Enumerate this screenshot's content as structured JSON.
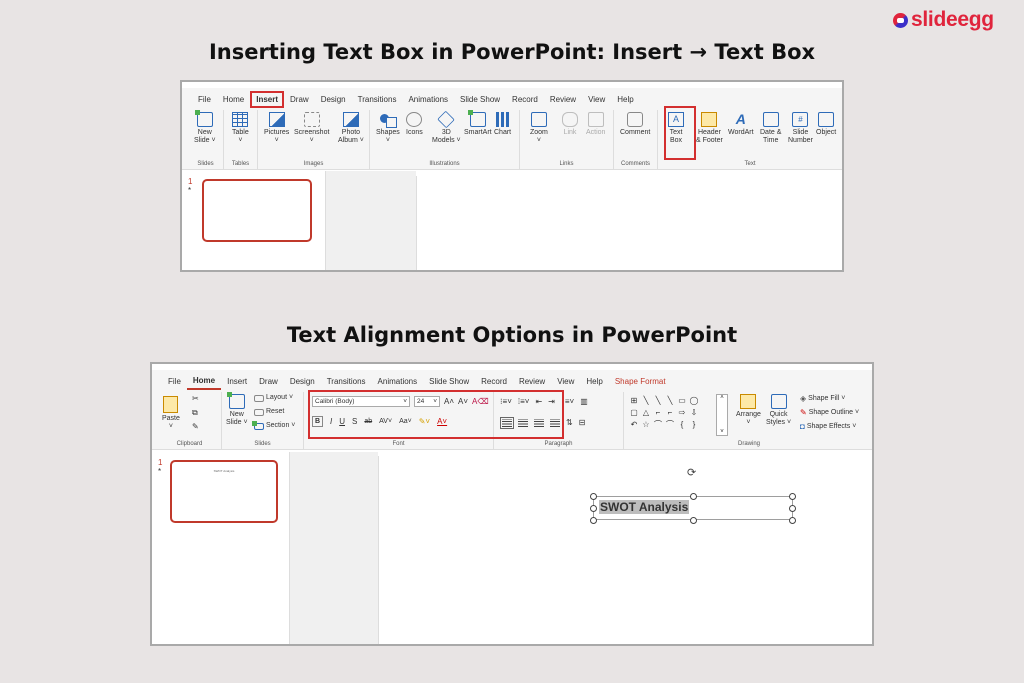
{
  "brand": {
    "name": "slideegg"
  },
  "heading1": "Inserting  Text Box in PowerPoint: Insert → Text Box",
  "heading2": "Text Alignment Options in PowerPoint",
  "shot1": {
    "tabs": [
      "File",
      "Home",
      "Insert",
      "Draw",
      "Design",
      "Transitions",
      "Animations",
      "Slide Show",
      "Record",
      "Review",
      "View",
      "Help"
    ],
    "active_tab": "Insert",
    "groups": {
      "slides": "Slides",
      "tables": "Tables",
      "images": "Images",
      "illustrations": "Illustrations",
      "links": "Links",
      "comments": "Comments",
      "text": "Text"
    },
    "buttons": {
      "new_slide_1": "New",
      "new_slide_2": "Slide ˅",
      "table": "Table",
      "pictures": "Pictures",
      "screenshot": "Screenshot",
      "photo_album_1": "Photo",
      "photo_album_2": "Album ˅",
      "shapes": "Shapes",
      "icons": "Icons",
      "models_1": "3D",
      "models_2": "Models ˅",
      "smartart": "SmartArt",
      "chart": "Chart",
      "zoom": "Zoom",
      "link": "Link",
      "action": "Action",
      "comment": "Comment",
      "text_box_1": "Text",
      "text_box_2": "Box",
      "header_1": "Header",
      "header_2": "& Footer",
      "wordart": "WordArt",
      "datetime_1": "Date &",
      "datetime_2": "Time",
      "slidenum_1": "Slide",
      "slidenum_2": "Number",
      "object": "Object"
    },
    "slide_number": "1",
    "slide_marker": "*"
  },
  "shot2": {
    "tabs": [
      "File",
      "Home",
      "Insert",
      "Draw",
      "Design",
      "Transitions",
      "Animations",
      "Slide Show",
      "Record",
      "Review",
      "View",
      "Help",
      "Shape Format"
    ],
    "active_tab": "Home",
    "groups": {
      "clipboard": "Clipboard",
      "slides": "Slides",
      "font": "Font",
      "paragraph": "Paragraph",
      "drawing": "Drawing"
    },
    "buttons": {
      "paste": "Paste",
      "new_slide_1": "New",
      "new_slide_2": "Slide ˅",
      "layout": "Layout ˅",
      "reset": "Reset",
      "section": "Section ˅",
      "arrange": "Arrange",
      "quick_styles_1": "Quick",
      "quick_styles_2": "Styles ˅",
      "shape_fill": "Shape Fill ˅",
      "shape_outline": "Shape Outline ˅",
      "shape_effects": "Shape Effects ˅"
    },
    "font_name": "Calibri (Body)",
    "font_size": "24",
    "format_buttons": {
      "bold": "B",
      "italic": "I",
      "underline": "U",
      "strike": "S"
    },
    "slide_number": "1",
    "slide_marker": "*",
    "thumb_text": "SWOT Analysis",
    "textbox_text": "SWOT Analysis"
  },
  "colors": {
    "accent_red": "#d32f2f",
    "brand_red": "#e0243c",
    "ribbon_blue": "#2e6bb8"
  }
}
